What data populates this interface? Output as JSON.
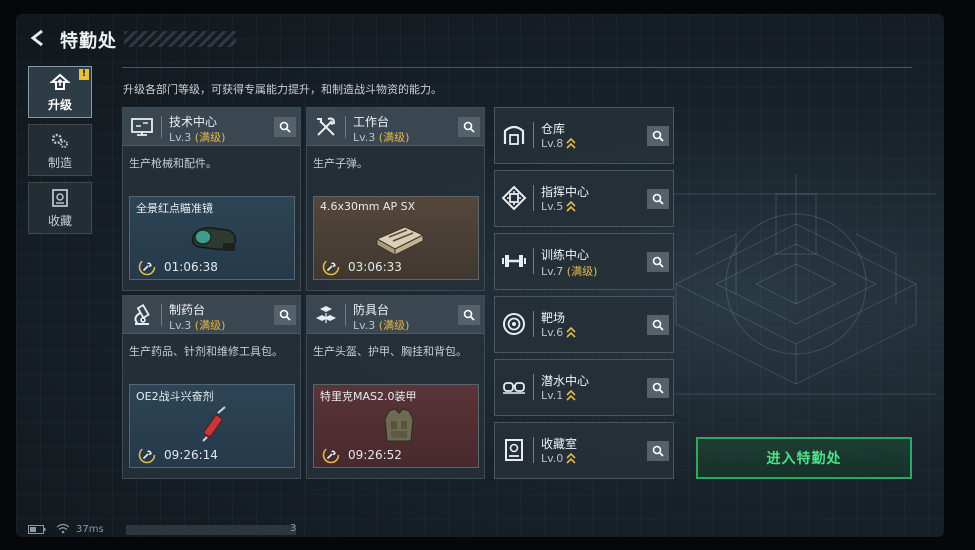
{
  "header": {
    "title": "特勤处"
  },
  "sidebar": {
    "tabs": [
      {
        "label": "升级",
        "icon": "upgrade-icon",
        "active": true,
        "badge": "!"
      },
      {
        "label": "制造",
        "icon": "gears-icon",
        "active": false
      },
      {
        "label": "收藏",
        "icon": "collection-icon",
        "active": false
      }
    ]
  },
  "description": "升级各部门等级，可获得专属能力提升，和制造战斗物资的能力。",
  "facilities": [
    {
      "name": "技术中心",
      "level": "Lv.3",
      "max_label": "(满级)",
      "icon": "computer-icon",
      "desc": "生产枪械和配件。",
      "product": "全景红点瞄准镜",
      "timer": "01:06:38",
      "product_icon": "scope-icon"
    },
    {
      "name": "工作台",
      "level": "Lv.3",
      "max_label": "(满级)",
      "icon": "tools-icon",
      "desc": "生产子弹。",
      "product": "4.6x30mm AP SX",
      "timer": "03:06:33",
      "product_icon": "ammo-box-icon"
    },
    {
      "name": "制药台",
      "level": "Lv.3",
      "max_label": "(满级)",
      "icon": "microscope-icon",
      "desc": "生产药品、针剂和维修工具包。",
      "product": "OE2战斗兴奋剂",
      "timer": "09:26:14",
      "product_icon": "syringe-icon"
    },
    {
      "name": "防具台",
      "level": "Lv.3",
      "max_label": "(满级)",
      "icon": "armor-blocks-icon",
      "desc": "生产头盔、护甲、胸挂和背包。",
      "product": "特里克MAS2.0装甲",
      "timer": "09:26:52",
      "product_icon": "body-armor-icon"
    }
  ],
  "departments": [
    {
      "name": "仓库",
      "level": "Lv.8",
      "icon": "warehouse-icon",
      "upgradable": true
    },
    {
      "name": "指挥中心",
      "level": "Lv.5",
      "icon": "command-center-icon",
      "upgradable": true
    },
    {
      "name": "训练中心",
      "level": "Lv.7",
      "max_label": "(满级)",
      "icon": "dumbbell-icon",
      "upgradable": true
    },
    {
      "name": "靶场",
      "level": "Lv.6",
      "icon": "target-icon",
      "upgradable": true
    },
    {
      "name": "潜水中心",
      "level": "Lv.1",
      "icon": "diving-mask-icon",
      "upgradable": true
    },
    {
      "name": "收藏室",
      "level": "Lv.0",
      "icon": "collection-room-icon",
      "upgradable": true
    }
  ],
  "enter_button": "进入特勤处",
  "status": {
    "ping": "37ms",
    "page": "3"
  },
  "colors": {
    "max_level": "#e3b94a",
    "enter_green": "#4fe08a",
    "badge": "#e8c13a"
  }
}
